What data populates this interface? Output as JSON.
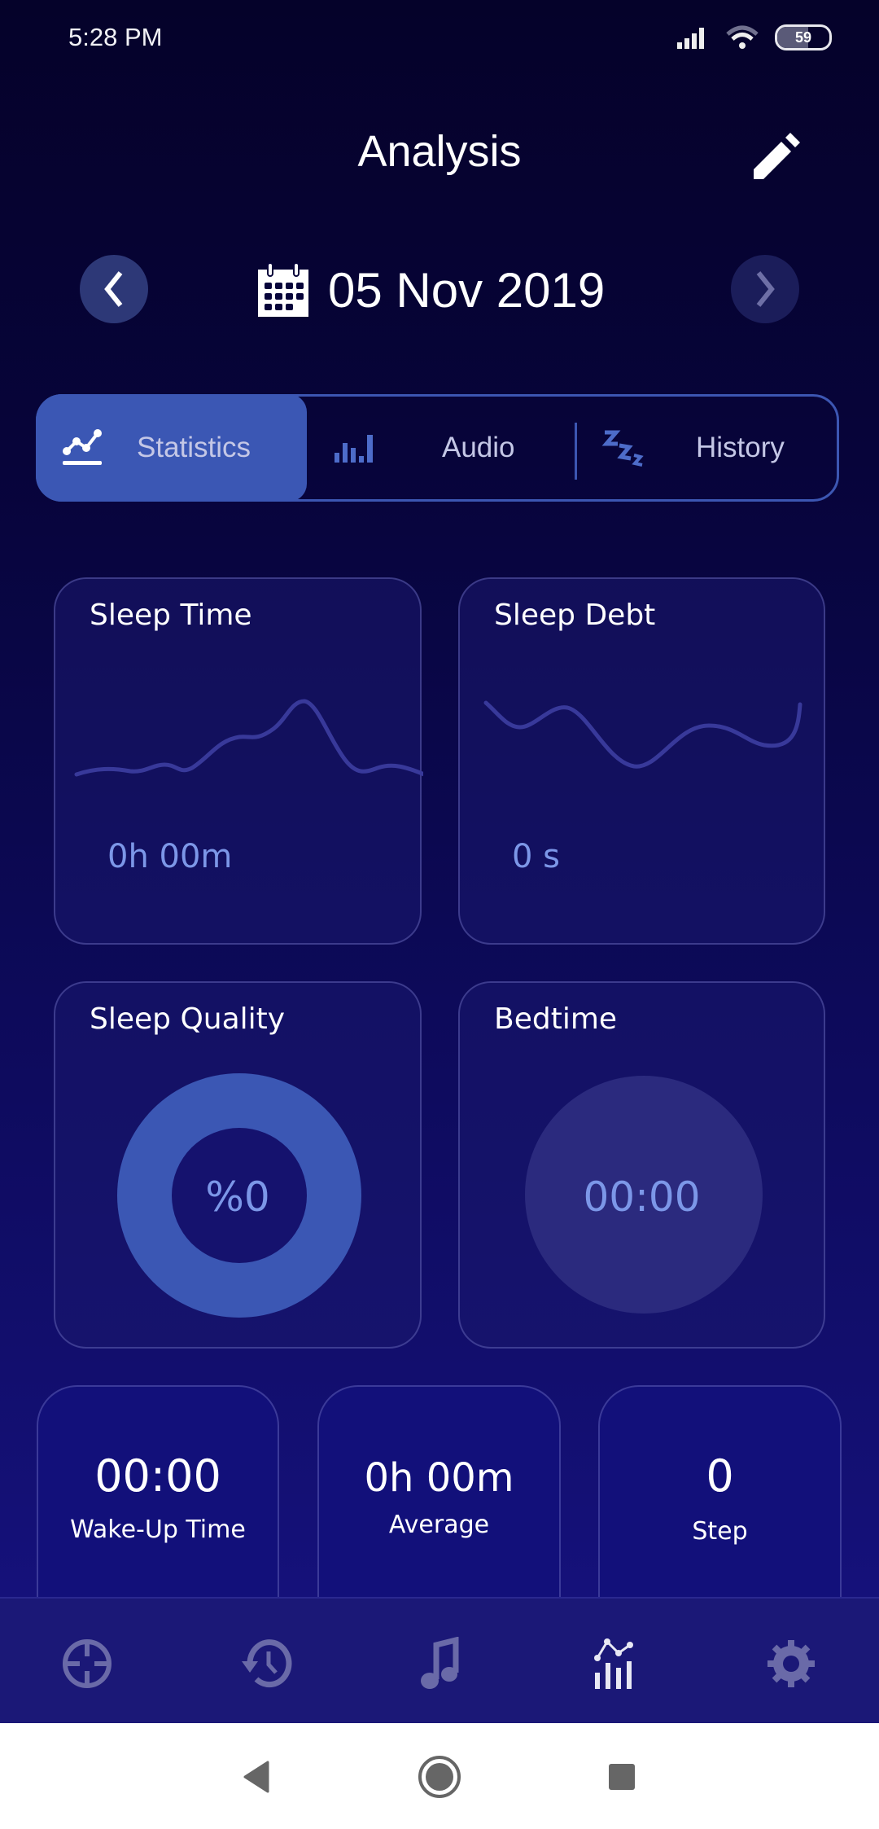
{
  "status_bar": {
    "time": "5:28 PM",
    "battery": "59",
    "battery_level": 0.59
  },
  "header": {
    "title": "Analysis",
    "edit_icon": "pencil-icon"
  },
  "date_nav": {
    "date": "05 Nov 2019",
    "prev_icon": "chevron-left-icon",
    "next_icon": "chevron-right-icon",
    "calendar_icon": "calendar-icon"
  },
  "tabs": [
    {
      "label": "Statistics",
      "icon": "line-chart-icon",
      "active": true
    },
    {
      "label": "Audio",
      "icon": "bar-chart-icon",
      "active": false
    },
    {
      "label": "History",
      "icon": "zzz-icon",
      "active": false
    }
  ],
  "cards": {
    "sleep_time": {
      "title": "Sleep Time",
      "value": "0h 00m"
    },
    "sleep_debt": {
      "title": "Sleep Debt",
      "value": "0 s"
    },
    "sleep_quality": {
      "title": "Sleep Quality",
      "value": "%0",
      "percent": 0
    },
    "bedtime": {
      "title": "Bedtime",
      "value": "00:00"
    }
  },
  "summary": [
    {
      "value": "00:00",
      "label": "Wake-Up Time"
    },
    {
      "value": "0h 00m",
      "label": "Average"
    },
    {
      "value": "0",
      "label": "Step"
    }
  ],
  "bottom_nav": [
    {
      "name": "sleep",
      "icon": "target-icon",
      "active": false
    },
    {
      "name": "history",
      "icon": "history-icon",
      "active": false
    },
    {
      "name": "music",
      "icon": "music-note-icon",
      "active": false
    },
    {
      "name": "analysis",
      "icon": "analytics-icon",
      "active": true
    },
    {
      "name": "settings",
      "icon": "gear-icon",
      "active": false
    }
  ],
  "system_nav": [
    "back",
    "home",
    "recents"
  ],
  "colors": {
    "accent": "#3b57b4",
    "value_text": "#7c97e8",
    "inactive_icon": "#6a6aa8",
    "wave": "#3a3a9a"
  }
}
